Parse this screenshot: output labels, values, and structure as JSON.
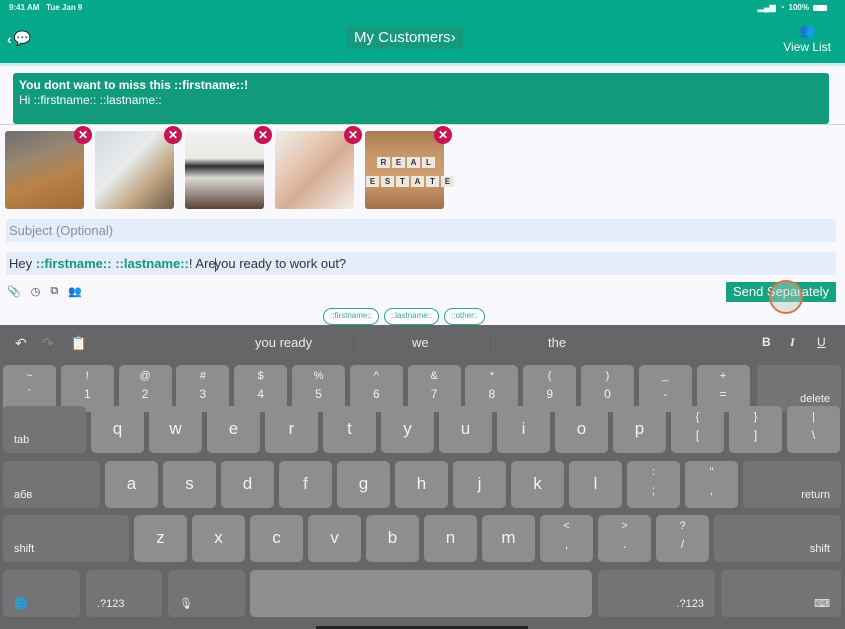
{
  "status_bar": {
    "time": "9:41 AM",
    "date": "Tue Jan 9",
    "battery": "100%"
  },
  "header": {
    "back_icon": "chat-bubbles-icon",
    "title": "My Customers",
    "title_chevron": "›",
    "view_list_label": "View List",
    "view_list_icon": "group-icon",
    "accent_color": "#05a88a"
  },
  "preview": {
    "subject": "You dont want to miss this ::firstname::!",
    "body": "Hi ::firstname:: ::lastname::"
  },
  "attachments": [
    {
      "alt": "toy house with keys"
    },
    {
      "alt": "modern staircase interior"
    },
    {
      "alt": "kitchen interior"
    },
    {
      "alt": "hand holding keys"
    },
    {
      "alt": "REAL ESTATE letter tiles",
      "tiles_line1": "REAL",
      "tiles_line2": "ESTATE"
    }
  ],
  "compose": {
    "subject_placeholder": "Subject (Optional)",
    "body_prefix": "Hey ",
    "token_firstname": "::firstname::",
    "token_lastname": "::lastname::",
    "body_mid": "! Are",
    "body_suffix": "you ready to work out?",
    "send_label": "Send Separately",
    "tools": [
      "paperclip-icon",
      "clock-icon",
      "copy-icon",
      "group-icon"
    ]
  },
  "chips": [
    "::firstname::",
    "::lastname::",
    "::other::"
  ],
  "keyboard": {
    "suggestions": [
      "you ready",
      "we",
      "the"
    ],
    "format": {
      "bold": "B",
      "italic": "I",
      "underline": "U"
    },
    "number_row": [
      {
        "top": "~",
        "bot": "`"
      },
      {
        "top": "!",
        "bot": "1"
      },
      {
        "top": "@",
        "bot": "2"
      },
      {
        "top": "#",
        "bot": "3"
      },
      {
        "top": "$",
        "bot": "4"
      },
      {
        "top": "%",
        "bot": "5"
      },
      {
        "top": "^",
        "bot": "6"
      },
      {
        "top": "&",
        "bot": "7"
      },
      {
        "top": "*",
        "bot": "8"
      },
      {
        "top": "(",
        "bot": "9"
      },
      {
        "top": ")",
        "bot": "0"
      },
      {
        "top": "_",
        "bot": "-"
      },
      {
        "top": "+",
        "bot": "="
      }
    ],
    "delete": "delete",
    "tab": "tab",
    "row1": [
      "q",
      "w",
      "e",
      "r",
      "t",
      "y",
      "u",
      "i",
      "o",
      "p"
    ],
    "row1_sym": [
      {
        "top": "{",
        "bot": "["
      },
      {
        "top": "}",
        "bot": "]"
      },
      {
        "top": "|",
        "bot": "\\"
      }
    ],
    "caps": "абв",
    "row2": [
      "a",
      "s",
      "d",
      "f",
      "g",
      "h",
      "j",
      "k",
      "l"
    ],
    "row2_sym": [
      {
        "top": ":",
        "bot": ";"
      },
      {
        "top": "\"",
        "bot": ","
      }
    ],
    "return": "return",
    "shift": "shift",
    "row3": [
      "z",
      "x",
      "c",
      "v",
      "b",
      "n",
      "m"
    ],
    "row3_sym": [
      {
        "top": "<",
        "bot": ","
      },
      {
        "top": ">",
        "bot": "."
      },
      {
        "top": "?",
        "bot": "/"
      }
    ],
    "numbers": ".?123"
  }
}
